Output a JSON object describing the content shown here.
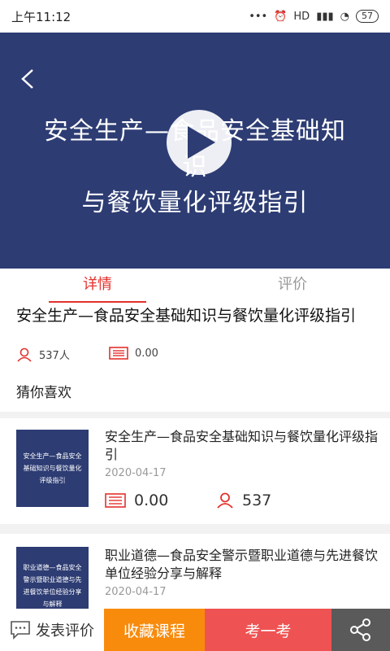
{
  "status_bar": {
    "time": "上午11:12",
    "dots": "•••",
    "network": "HD",
    "battery": "57"
  },
  "video": {
    "title_line1": "安全生产—食品安全基础知识",
    "title_line2": "与餐饮量化评级指引"
  },
  "tabs": [
    {
      "label": "详情",
      "active": true
    },
    {
      "label": "评价",
      "active": false
    }
  ],
  "course": {
    "title": "安全生产—食品安全基础知识与餐饮量化评级指引",
    "learners": "537人",
    "price": "0.00"
  },
  "recommend": {
    "heading": "猜你喜欢",
    "items": [
      {
        "thumb_text": "安全生产—食品安全基础知识与餐饮量化评级指引",
        "title": "安全生产—食品安全基础知识与餐饮量化评级指引",
        "date": "2020-04-17",
        "price": "0.00",
        "learners": "537"
      },
      {
        "thumb_text": "职业道德—食品安全警示暨职业道德与先进餐饮单位经验分享与解释",
        "title": "职业道德—食品安全警示暨职业道德与先进餐饮单位经验分享与解释",
        "date": "2020-04-17"
      }
    ]
  },
  "bottom_bar": {
    "comment": "发表评价",
    "favorite": "收藏课程",
    "exam": "考一考"
  },
  "colors": {
    "accent": "#e3312d",
    "video_bg": "#2d3c73",
    "favorite": "#f88b0c",
    "exam": "#ef5252"
  }
}
